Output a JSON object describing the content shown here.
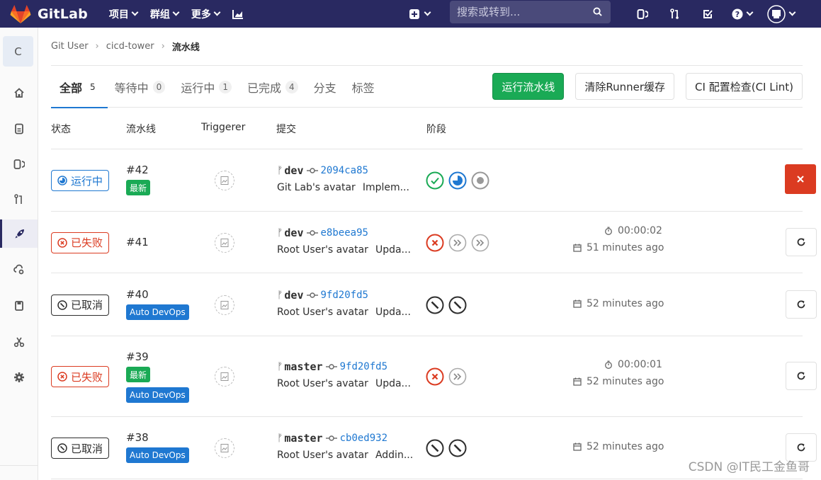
{
  "app": {
    "name": "GitLab"
  },
  "nav": {
    "items": [
      {
        "label": "项目"
      },
      {
        "label": "群组"
      },
      {
        "label": "更多"
      }
    ],
    "search_placeholder": "搜索或转到..."
  },
  "sidebar": {
    "project_letter": "C"
  },
  "breadcrumb": {
    "items": [
      "Git User",
      "cicd-tower",
      "流水线"
    ]
  },
  "tabs": [
    {
      "label": "全部",
      "count": "5"
    },
    {
      "label": "等待中",
      "count": "0"
    },
    {
      "label": "运行中",
      "count": "1"
    },
    {
      "label": "已完成",
      "count": "4"
    },
    {
      "label": "分支",
      "count": ""
    },
    {
      "label": "标签",
      "count": ""
    }
  ],
  "buttons": {
    "run": "运行流水线",
    "clear_cache": "清除Runner缓存",
    "ci_lint": "CI 配置检查(CI Lint)"
  },
  "table": {
    "headers": {
      "status": "状态",
      "pipeline": "流水线",
      "triggerer": "Triggerer",
      "commit": "提交",
      "stages": "阶段"
    },
    "rows": [
      {
        "status": "运行中",
        "status_kind": "running",
        "id": "#42",
        "labels": [
          "最新"
        ],
        "branch": "dev",
        "sha": "2094ca85",
        "author": "Git Lab's avatar",
        "message": "Implem...",
        "stages": [
          "success",
          "running",
          "created"
        ],
        "duration": "",
        "finished": "",
        "action": "cancel"
      },
      {
        "status": "已失败",
        "status_kind": "failed",
        "id": "#41",
        "labels": [],
        "branch": "dev",
        "sha": "e8beea95",
        "author": "Root User's avatar",
        "message": "Upda...",
        "stages": [
          "failed",
          "skipped",
          "skipped"
        ],
        "duration": "00:00:02",
        "finished": "51 minutes ago",
        "action": "retry"
      },
      {
        "status": "已取消",
        "status_kind": "canceled",
        "id": "#40",
        "labels": [
          "Auto DevOps"
        ],
        "branch": "dev",
        "sha": "9fd20fd5",
        "author": "Root User's avatar",
        "message": "Upda...",
        "stages": [
          "canceled",
          "canceled"
        ],
        "duration": "",
        "finished": "52 minutes ago",
        "action": "retry"
      },
      {
        "status": "已失败",
        "status_kind": "failed",
        "id": "#39",
        "labels": [
          "最新",
          "Auto DevOps"
        ],
        "branch": "master",
        "sha": "9fd20fd5",
        "author": "Root User's avatar",
        "message": "Upda...",
        "stages": [
          "failed",
          "skipped"
        ],
        "duration": "00:00:01",
        "finished": "52 minutes ago",
        "action": "retry"
      },
      {
        "status": "已取消",
        "status_kind": "canceled",
        "id": "#38",
        "labels": [
          "Auto DevOps"
        ],
        "branch": "master",
        "sha": "cb0ed932",
        "author": "Root User's avatar",
        "message": "Addin...",
        "stages": [
          "canceled",
          "canceled"
        ],
        "duration": "",
        "finished": "52 minutes ago",
        "action": "retry"
      }
    ]
  },
  "watermark": "CSDN @IT民工金鱼哥",
  "colors": {
    "nav": "#292961",
    "success": "#1aaa55",
    "failed": "#db3b21",
    "running": "#1f78d1",
    "link": "#1f78d1"
  }
}
